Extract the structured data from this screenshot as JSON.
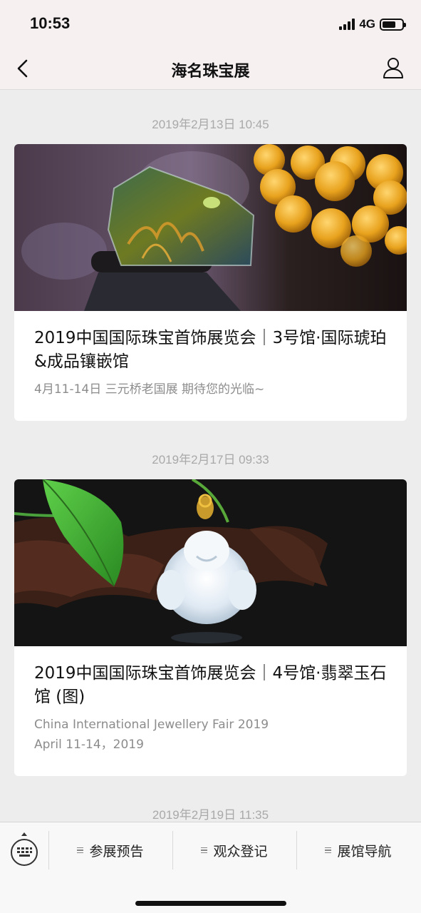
{
  "status_bar": {
    "time": "10:53",
    "network": "4G",
    "battery_level": 0.7
  },
  "nav": {
    "title": "海名珠宝展",
    "back_icon": "chevron-left-icon",
    "profile_icon": "person-icon"
  },
  "feed": [
    {
      "timestamp": "2019年2月13日 10:45",
      "title": "2019中国国际珠宝首饰展览会｜3号馆·国际琥珀&成品镶嵌馆",
      "description": "4月11-14日 三元桥老国展 期待您的光临~",
      "image": "amber-specimen-and-beads-photo"
    },
    {
      "timestamp": "2019年2月17日 09:33",
      "title": "2019中国国际珠宝首饰展览会｜4号馆·翡翠玉石馆 (图)",
      "description_lines": [
        "China International Jewellery Fair 2019",
        "April 11-14，2019"
      ],
      "image": "jade-buddha-pendant-photo"
    },
    {
      "timestamp": "2019年2月19日 11:35"
    }
  ],
  "bottom_menu": {
    "keyboard_icon": "keyboard-icon",
    "items": [
      {
        "label": "参展预告"
      },
      {
        "label": "观众登记"
      },
      {
        "label": "展馆导航"
      }
    ]
  },
  "colors": {
    "background": "#ededed",
    "card": "#ffffff",
    "timestamp_text": "#a9a9a9",
    "desc_text": "#8c8c8c",
    "nav_bg": "#f6f0f1"
  }
}
